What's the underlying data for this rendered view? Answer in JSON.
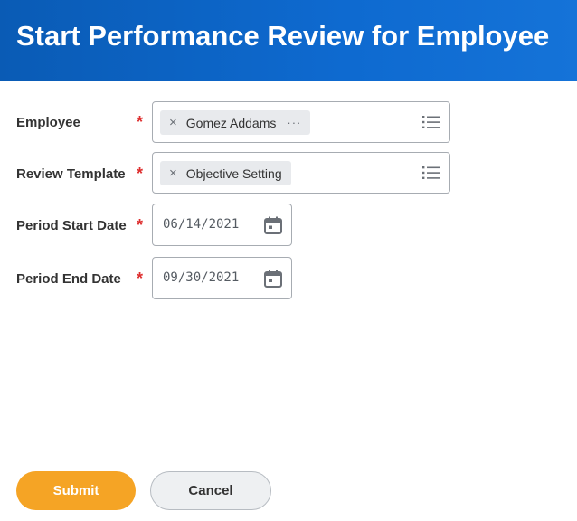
{
  "header": {
    "title": "Start Performance Review for Employee"
  },
  "form": {
    "required_marker": "*",
    "employee": {
      "label": "Employee",
      "selected_value": "Gomez Addams",
      "remove_glyph": "×",
      "more_glyph": "···"
    },
    "review_template": {
      "label": "Review Template",
      "selected_value": "Objective Setting",
      "remove_glyph": "×"
    },
    "period_start_date": {
      "label": "Period Start Date",
      "value": "06/14/2021"
    },
    "period_end_date": {
      "label": "Period End Date",
      "value": "09/30/2021"
    }
  },
  "footer": {
    "submit_label": "Submit",
    "cancel_label": "Cancel"
  },
  "colors": {
    "header_blue": "#0e6ad0",
    "required_red": "#de2f2f",
    "submit_orange": "#f5a425"
  },
  "icons": {
    "prompt_list": "list-icon",
    "date_picker": "calendar-icon",
    "remove": "close-icon",
    "related_actions": "more-icon"
  }
}
